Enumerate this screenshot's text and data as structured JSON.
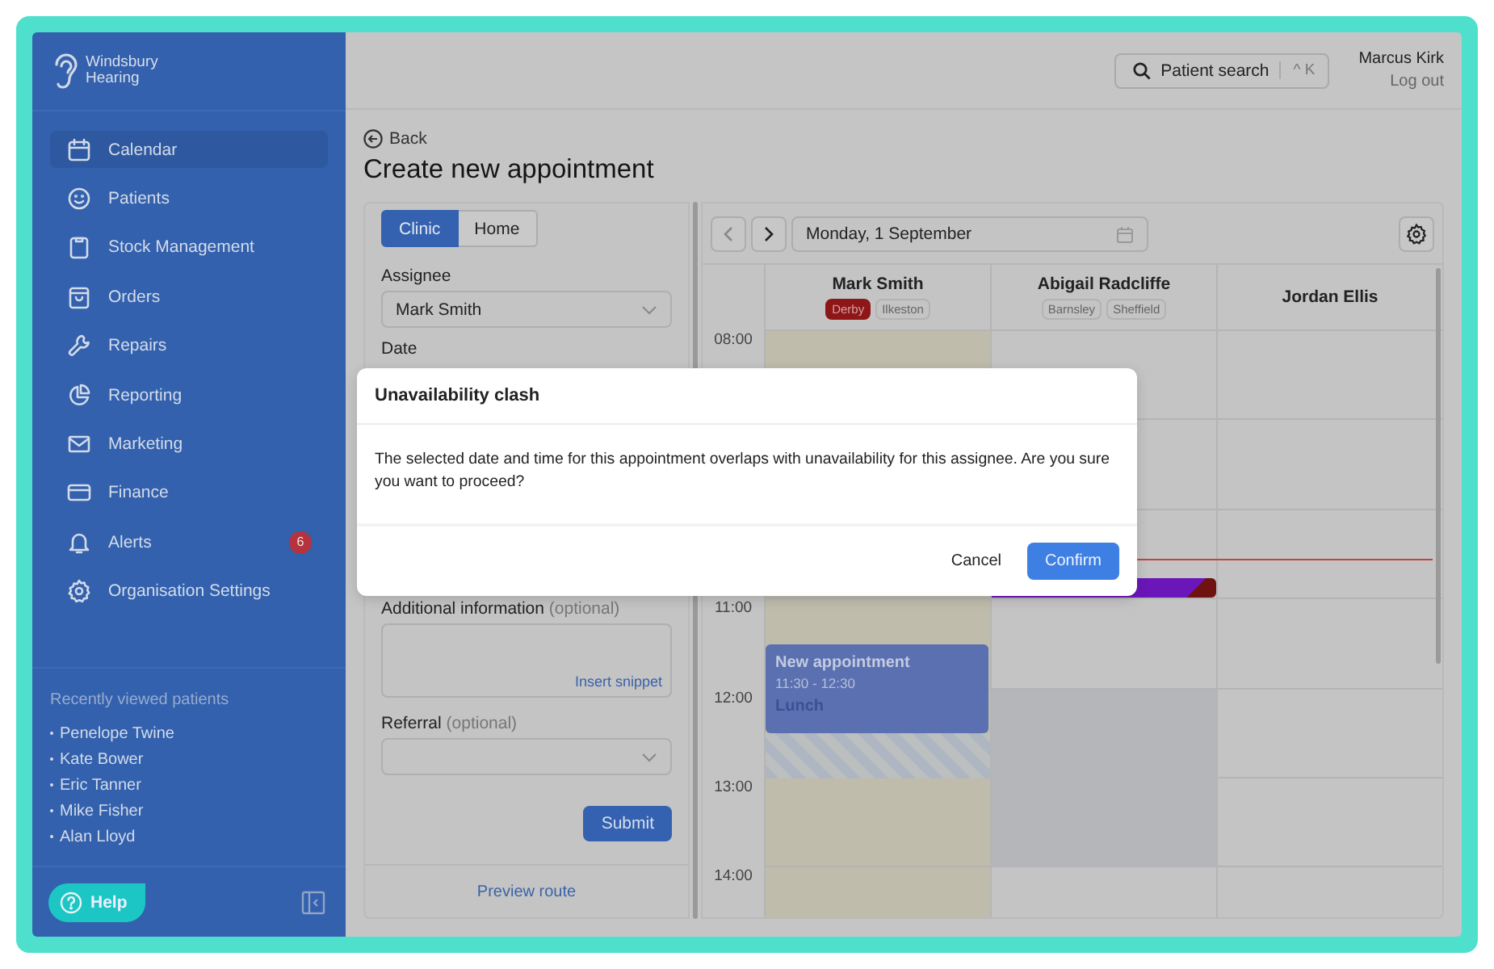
{
  "brand": "Windsbury Hearing",
  "nav": [
    {
      "label": "Calendar",
      "selected": true
    },
    {
      "label": "Patients",
      "selected": false
    },
    {
      "label": "Stock Management",
      "selected": false
    },
    {
      "label": "Orders",
      "selected": false
    },
    {
      "label": "Repairs",
      "selected": false
    },
    {
      "label": "Reporting",
      "selected": false
    },
    {
      "label": "Marketing",
      "selected": false
    },
    {
      "label": "Finance",
      "selected": false
    },
    {
      "label": "Alerts",
      "selected": false,
      "badge": "6"
    },
    {
      "label": "Organisation Settings",
      "selected": false
    }
  ],
  "recent": {
    "title": "Recently viewed patients",
    "patients": [
      "Penelope Twine",
      "Kate Bower",
      "Eric Tanner",
      "Mike Fisher",
      "Alan Lloyd"
    ]
  },
  "help": "Help",
  "header": {
    "search": "Patient search",
    "shortcut": "^ K",
    "user": "Marcus Kirk",
    "logout": "Log out"
  },
  "back": "Back",
  "title": "Create new appointment",
  "form": {
    "tabs": [
      {
        "label": "Clinic",
        "selected": true
      },
      {
        "label": "Home",
        "selected": false
      }
    ],
    "assignee": {
      "label": "Assignee",
      "value": "Mark Smith"
    },
    "date": {
      "label": "Date"
    },
    "additional": {
      "label": "Additional information",
      "hint": "(optional)",
      "snippet": "Insert snippet"
    },
    "referral": {
      "label": "Referral",
      "hint": "(optional)"
    },
    "submit": "Submit",
    "preview": "Preview route"
  },
  "calendar": {
    "date": "Monday, 1 September",
    "assignees": [
      {
        "name": "Mark Smith",
        "locations": [
          {
            "label": "Derby",
            "selected": true
          },
          {
            "label": "Ilkeston",
            "selected": false
          }
        ]
      },
      {
        "name": "Abigail Radcliffe",
        "locations": [
          {
            "label": "Barnsley",
            "selected": false
          },
          {
            "label": "Sheffield",
            "selected": false
          }
        ]
      },
      {
        "name": "Jordan Ellis"
      }
    ],
    "times": [
      "08:00",
      "11:00",
      "12:00",
      "13:00",
      "14:00"
    ],
    "appointment": {
      "title": "New appointment",
      "time": "11:30 - 12:30",
      "note": "Lunch"
    }
  },
  "modal": {
    "title": "Unavailability clash",
    "body": "The selected date and time for this appointment overlaps with unavailability for this assignee. Are you sure you want to proceed?",
    "cancel": "Cancel",
    "confirm": "Confirm"
  }
}
